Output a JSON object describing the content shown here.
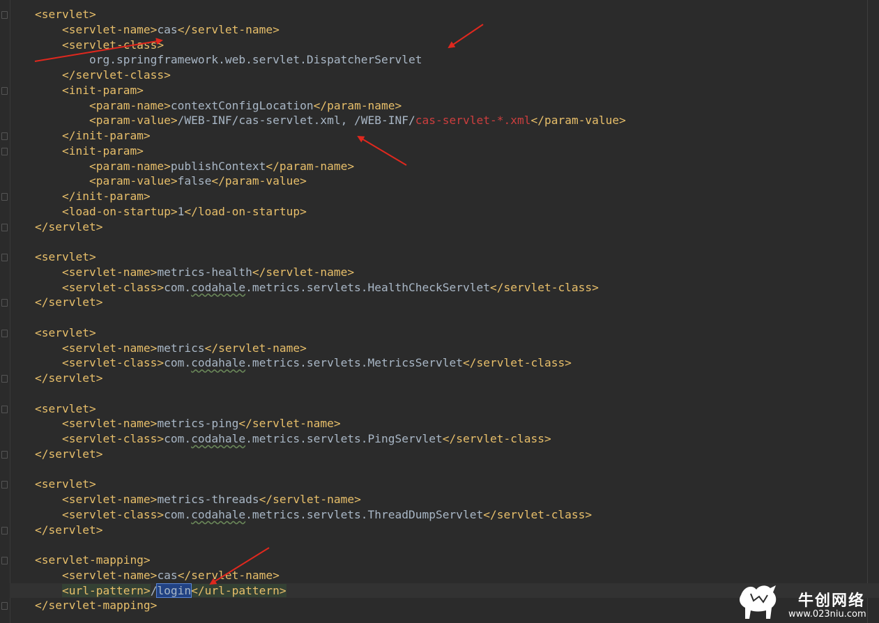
{
  "lines": [
    {
      "i": "",
      "p": [
        {
          "c": "tag",
          "t": "<servlet>"
        }
      ]
    },
    {
      "i": "    ",
      "p": [
        {
          "c": "tag",
          "t": "<servlet-name>"
        },
        {
          "c": "txt",
          "t": "cas"
        },
        {
          "c": "tag",
          "t": "</servlet-name>"
        }
      ]
    },
    {
      "i": "    ",
      "p": [
        {
          "c": "tag",
          "t": "<servlet-class>"
        }
      ]
    },
    {
      "i": "        ",
      "p": [
        {
          "c": "txt",
          "t": "org.springframework.web.servlet.DispatcherServlet"
        }
      ]
    },
    {
      "i": "    ",
      "p": [
        {
          "c": "tag",
          "t": "</servlet-class>"
        }
      ]
    },
    {
      "i": "    ",
      "p": [
        {
          "c": "tag",
          "t": "<init-param>"
        }
      ]
    },
    {
      "i": "        ",
      "p": [
        {
          "c": "tag",
          "t": "<param-name>"
        },
        {
          "c": "txt",
          "t": "contextConfigLocation"
        },
        {
          "c": "tag",
          "t": "</param-name>"
        }
      ]
    },
    {
      "i": "        ",
      "p": [
        {
          "c": "tag",
          "t": "<param-value>"
        },
        {
          "c": "txt",
          "t": "/WEB-INF/cas-servlet.xml, /WEB-INF/"
        },
        {
          "c": "red",
          "t": "cas-servlet-*.xml"
        },
        {
          "c": "tag",
          "t": "</param-value>"
        }
      ]
    },
    {
      "i": "    ",
      "p": [
        {
          "c": "tag",
          "t": "</init-param>"
        }
      ]
    },
    {
      "i": "    ",
      "p": [
        {
          "c": "tag",
          "t": "<init-param>"
        }
      ]
    },
    {
      "i": "        ",
      "p": [
        {
          "c": "tag",
          "t": "<param-name>"
        },
        {
          "c": "txt",
          "t": "publishContext"
        },
        {
          "c": "tag",
          "t": "</param-name>"
        }
      ]
    },
    {
      "i": "        ",
      "p": [
        {
          "c": "tag",
          "t": "<param-value>"
        },
        {
          "c": "txt",
          "t": "false"
        },
        {
          "c": "tag",
          "t": "</param-value>"
        }
      ]
    },
    {
      "i": "    ",
      "p": [
        {
          "c": "tag",
          "t": "</init-param>"
        }
      ]
    },
    {
      "i": "    ",
      "p": [
        {
          "c": "tag",
          "t": "<load-on-startup>"
        },
        {
          "c": "txt",
          "t": "1"
        },
        {
          "c": "tag",
          "t": "</load-on-startup>"
        }
      ]
    },
    {
      "i": "",
      "p": [
        {
          "c": "tag",
          "t": "</servlet>"
        }
      ]
    },
    {
      "i": "",
      "p": []
    },
    {
      "i": "",
      "p": [
        {
          "c": "tag",
          "t": "<servlet>"
        }
      ]
    },
    {
      "i": "    ",
      "p": [
        {
          "c": "tag",
          "t": "<servlet-name>"
        },
        {
          "c": "txt",
          "t": "metrics-health"
        },
        {
          "c": "tag",
          "t": "</servlet-name>"
        }
      ]
    },
    {
      "i": "    ",
      "p": [
        {
          "c": "tag",
          "t": "<servlet-class>"
        },
        {
          "c": "txt",
          "t": "com."
        },
        {
          "c": "txt typo",
          "t": "codahale"
        },
        {
          "c": "txt",
          "t": ".metrics.servlets.HealthCheckServlet"
        },
        {
          "c": "tag",
          "t": "</servlet-class>"
        }
      ]
    },
    {
      "i": "",
      "p": [
        {
          "c": "tag",
          "t": "</servlet>"
        }
      ]
    },
    {
      "i": "",
      "p": []
    },
    {
      "i": "",
      "p": [
        {
          "c": "tag",
          "t": "<servlet>"
        }
      ]
    },
    {
      "i": "    ",
      "p": [
        {
          "c": "tag",
          "t": "<servlet-name>"
        },
        {
          "c": "txt",
          "t": "metrics"
        },
        {
          "c": "tag",
          "t": "</servlet-name>"
        }
      ]
    },
    {
      "i": "    ",
      "p": [
        {
          "c": "tag",
          "t": "<servlet-class>"
        },
        {
          "c": "txt",
          "t": "com."
        },
        {
          "c": "txt typo",
          "t": "codahale"
        },
        {
          "c": "txt",
          "t": ".metrics.servlets.MetricsServlet"
        },
        {
          "c": "tag",
          "t": "</servlet-class>"
        }
      ]
    },
    {
      "i": "",
      "p": [
        {
          "c": "tag",
          "t": "</servlet>"
        }
      ]
    },
    {
      "i": "",
      "p": []
    },
    {
      "i": "",
      "p": [
        {
          "c": "tag",
          "t": "<servlet>"
        }
      ]
    },
    {
      "i": "    ",
      "p": [
        {
          "c": "tag",
          "t": "<servlet-name>"
        },
        {
          "c": "txt",
          "t": "metrics-ping"
        },
        {
          "c": "tag",
          "t": "</servlet-name>"
        }
      ]
    },
    {
      "i": "    ",
      "p": [
        {
          "c": "tag",
          "t": "<servlet-class>"
        },
        {
          "c": "txt",
          "t": "com."
        },
        {
          "c": "txt typo",
          "t": "codahale"
        },
        {
          "c": "txt",
          "t": ".metrics.servlets.PingServlet"
        },
        {
          "c": "tag",
          "t": "</servlet-class>"
        }
      ]
    },
    {
      "i": "",
      "p": [
        {
          "c": "tag",
          "t": "</servlet>"
        }
      ]
    },
    {
      "i": "",
      "p": []
    },
    {
      "i": "",
      "p": [
        {
          "c": "tag",
          "t": "<servlet>"
        }
      ]
    },
    {
      "i": "    ",
      "p": [
        {
          "c": "tag",
          "t": "<servlet-name>"
        },
        {
          "c": "txt",
          "t": "metrics-threads"
        },
        {
          "c": "tag",
          "t": "</servlet-name>"
        }
      ]
    },
    {
      "i": "    ",
      "p": [
        {
          "c": "tag",
          "t": "<servlet-class>"
        },
        {
          "c": "txt",
          "t": "com."
        },
        {
          "c": "txt typo",
          "t": "codahale"
        },
        {
          "c": "txt",
          "t": ".metrics.servlets.ThreadDumpServlet"
        },
        {
          "c": "tag",
          "t": "</servlet-class>"
        }
      ]
    },
    {
      "i": "",
      "p": [
        {
          "c": "tag",
          "t": "</servlet>"
        }
      ]
    },
    {
      "i": "",
      "p": []
    },
    {
      "i": "",
      "p": [
        {
          "c": "tag",
          "t": "<servlet-mapping>"
        }
      ]
    },
    {
      "i": "    ",
      "p": [
        {
          "c": "tag",
          "t": "<servlet-name>"
        },
        {
          "c": "txt",
          "t": "cas"
        },
        {
          "c": "tag",
          "t": "</servlet-name>"
        }
      ]
    },
    {
      "i": "    ",
      "hl": true,
      "p": [
        {
          "c": "tag urltag",
          "t": "<url-pattern>"
        },
        {
          "c": "txt",
          "t": "/"
        },
        {
          "c": "sel",
          "t": "login"
        },
        {
          "c": "tag urltag",
          "t": "</url-pattern>"
        }
      ]
    },
    {
      "i": "",
      "p": [
        {
          "c": "tag",
          "t": "</servlet-mapping>"
        }
      ]
    }
  ],
  "colors": {
    "background": "#2b2b2b",
    "tag": "#e8bf6a",
    "text": "#a9b7c6",
    "error": "#cc3e3e",
    "arrow": "#e0281e"
  },
  "watermark": {
    "title": "牛创网络",
    "url": "www.023niu.com",
    "icon": "bull-logo-icon"
  }
}
